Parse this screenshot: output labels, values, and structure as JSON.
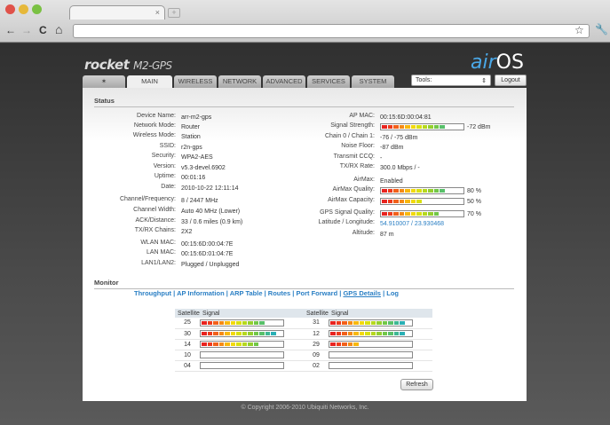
{
  "browser": {
    "tab_close": "×",
    "new_tab": "+",
    "back": "←",
    "forward": "→",
    "reload": "C",
    "home": "⌂",
    "star": "☆",
    "wrench": "🔧"
  },
  "header": {
    "product": "rocket",
    "model": "M2-GPS",
    "os_prefix": "air",
    "os_suffix": "OS",
    "tools_label": "Tools:",
    "logout_label": "Logout"
  },
  "tabs": [
    {
      "label": "MAIN",
      "active": true
    },
    {
      "label": "WIRELESS"
    },
    {
      "label": "NETWORK"
    },
    {
      "label": "ADVANCED"
    },
    {
      "label": "SERVICES"
    },
    {
      "label": "SYSTEM"
    }
  ],
  "status": {
    "title": "Status",
    "left": [
      {
        "label": "Device Name:",
        "value": "arr-m2-gps"
      },
      {
        "label": "Network Mode:",
        "value": "Router"
      },
      {
        "label": "Wireless Mode:",
        "value": "Station"
      },
      {
        "label": "SSID:",
        "value": "r2n-gps"
      },
      {
        "label": "Security:",
        "value": "WPA2-AES"
      },
      {
        "label": "Version:",
        "value": "v5.3-devel.6902"
      },
      {
        "label": "Uptime:",
        "value": "00:01:16"
      },
      {
        "label": "Date:",
        "value": "2010-10-22 12:11:14"
      },
      {
        "label": "Channel/Frequency:",
        "value": "8 / 2447 MHz"
      },
      {
        "label": "Channel Width:",
        "value": "Auto 40 MHz (Lower)"
      },
      {
        "label": "ACK/Distance:",
        "value": "33 / 0.6 miles (0.9 km)"
      },
      {
        "label": "TX/RX Chains:",
        "value": "2X2"
      },
      {
        "label": "WLAN MAC:",
        "value": "00:15:6D:00:04:7E"
      },
      {
        "label": "LAN MAC:",
        "value": "00:15:6D:01:04:7E"
      },
      {
        "label": "LAN1/LAN2:",
        "value": "Plugged / Unplugged"
      }
    ],
    "right": [
      {
        "label": "AP MAC:",
        "value": "00:15:6D:00:04:81"
      },
      {
        "label": "Signal Strength:",
        "value": "-72 dBm",
        "bar": 0.8
      },
      {
        "label": "Chain 0 / Chain 1:",
        "value": "-76 / -75 dBm"
      },
      {
        "label": "Noise Floor:",
        "value": "-87 dBm"
      },
      {
        "label": "Transmit CCQ:",
        "value": "-"
      },
      {
        "label": "TX/RX Rate:",
        "value": "300.0 Mbps / -"
      },
      {
        "label": "AirMax:",
        "value": "Enabled"
      },
      {
        "label": "AirMax Quality:",
        "value": "80 %",
        "bar": 0.8
      },
      {
        "label": "AirMax Capacity:",
        "value": "50 %",
        "bar": 0.5
      },
      {
        "label": "GPS Signal Quality:",
        "value": "70 %",
        "bar": 0.7
      },
      {
        "label": "Latitude / Longitude:",
        "value": "54.910007 / 23.930468",
        "link": true
      },
      {
        "label": "Altitude:",
        "value": "87 m"
      }
    ]
  },
  "monitor": {
    "title": "Monitor",
    "links": [
      "Throughput",
      "AP Information",
      "ARP Table",
      "Routes",
      "Port Forward",
      "GPS Details",
      "Log"
    ],
    "col_satellite": "Satellite",
    "col_signal": "Signal",
    "rows": [
      [
        {
          "sat": "25",
          "signal": 0.77
        },
        {
          "sat": "31",
          "signal": 0.92
        }
      ],
      [
        {
          "sat": "30",
          "signal": 0.93
        },
        {
          "sat": "12",
          "signal": 0.9
        }
      ],
      [
        {
          "sat": "14",
          "signal": 0.73
        },
        {
          "sat": "29",
          "signal": 0.33
        }
      ],
      [
        {
          "sat": "10",
          "signal": 0
        },
        {
          "sat": "09",
          "signal": 0
        }
      ],
      [
        {
          "sat": "04",
          "signal": 0
        },
        {
          "sat": "02",
          "signal": 0
        }
      ]
    ],
    "refresh_label": "Refresh"
  },
  "footer": "© Copyright 2006-2010 Ubiquiti Networks, Inc."
}
